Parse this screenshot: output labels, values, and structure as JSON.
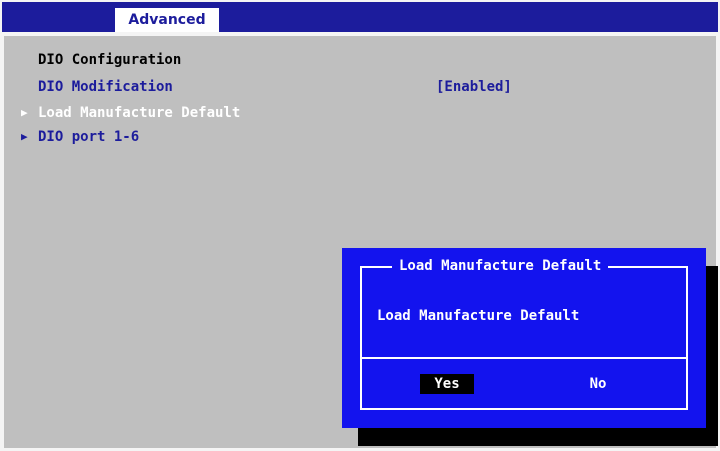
{
  "header": {
    "tabs": [
      {
        "label": "Advanced",
        "active": true
      }
    ],
    "bar_color": "#1c1c9c"
  },
  "main": {
    "heading": "DIO Configuration",
    "items": [
      {
        "label": "DIO Modification",
        "value": "[Enabled]",
        "type": "setting"
      },
      {
        "label": "Load Manufacture Default",
        "type": "submenu",
        "highlighted": true,
        "arrow_icon": "right-triangle-icon"
      },
      {
        "label": "DIO port 1-6",
        "type": "submenu",
        "highlighted": false,
        "arrow_icon": "right-triangle-icon"
      }
    ],
    "background_color": "#bfbfbf"
  },
  "dialog": {
    "title": "Load Manufacture Default",
    "message": "Load Manufacture Default",
    "buttons": [
      {
        "label": "Yes",
        "selected": true
      },
      {
        "label": "No",
        "selected": false
      }
    ],
    "background_color": "#1313ee"
  }
}
